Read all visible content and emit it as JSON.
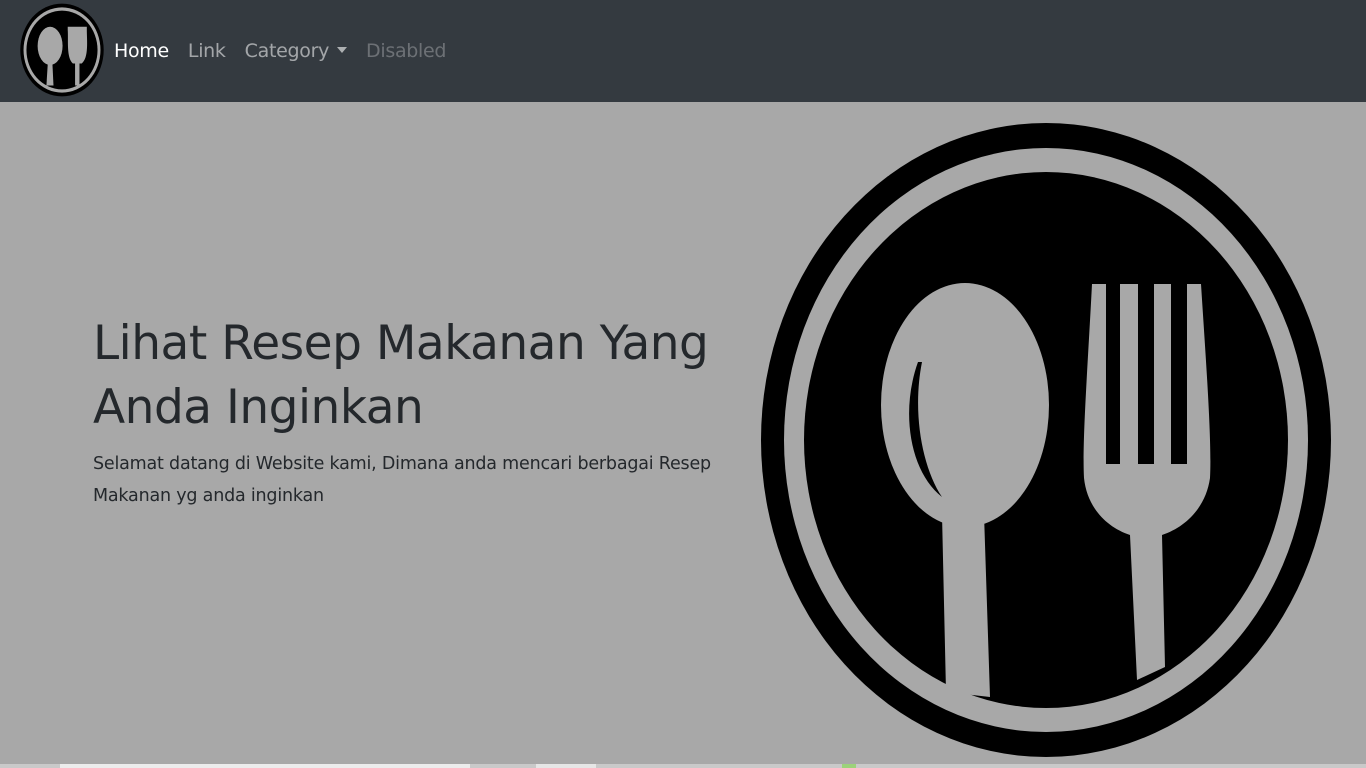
{
  "navbar": {
    "brand_icon": "plate-fork-spoon-icon",
    "background_color": "#343a40",
    "links": [
      {
        "label": "Home",
        "state": "active"
      },
      {
        "label": "Link",
        "state": "normal"
      },
      {
        "label": "Category",
        "state": "dropdown"
      },
      {
        "label": "Disabled",
        "state": "disabled"
      }
    ]
  },
  "hero": {
    "title": "Lihat Resep Makanan Yang Anda Inginkan",
    "lead": "Selamat datang di Website kami, Dimana anda mencari berbagai Resep Makanan yg anda inginkan",
    "image_icon": "plate-fork-spoon-icon",
    "background_color": "#a8a8a8"
  }
}
